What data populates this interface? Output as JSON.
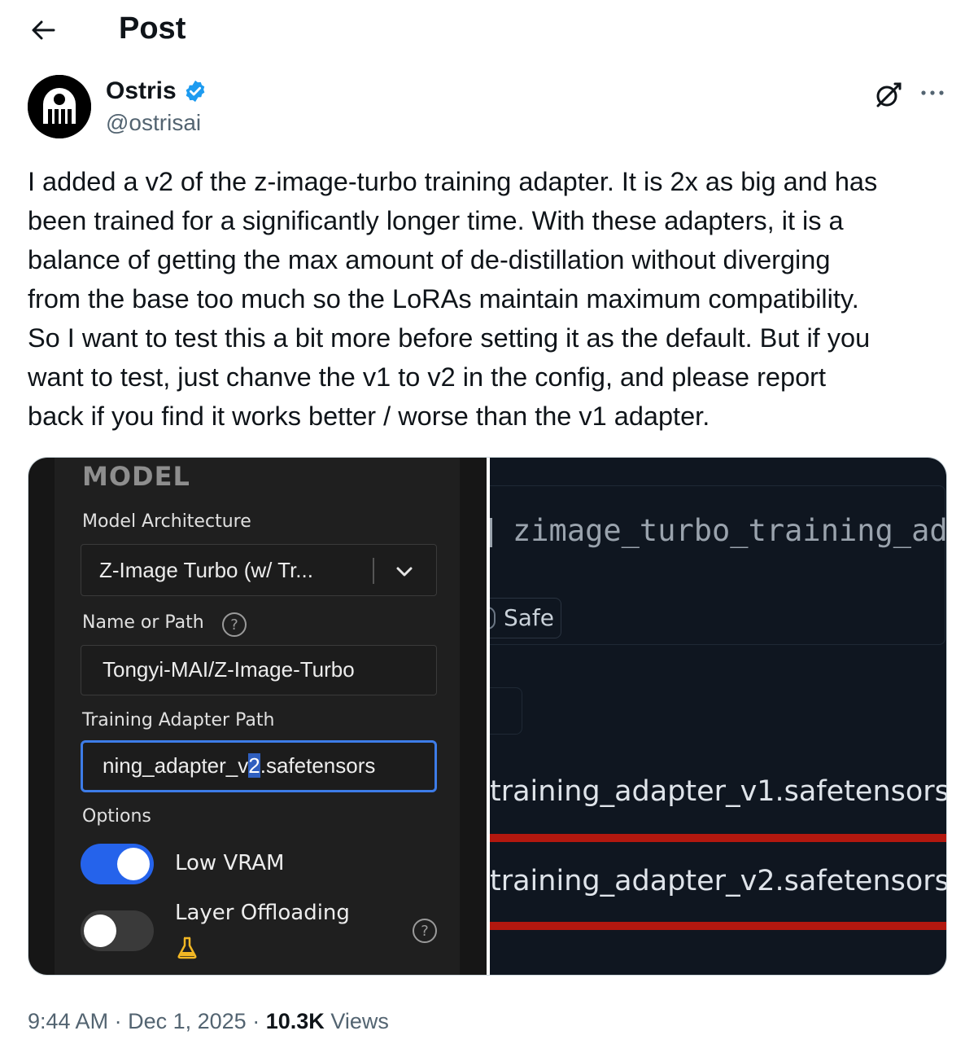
{
  "header": {
    "title": "Post"
  },
  "author": {
    "name": "Ostris",
    "handle": "@ostrisai",
    "verified": true
  },
  "post": {
    "text": "I added a v2 of the z-image-turbo training adapter. It is 2x as big and has\nbeen trained for a significantly longer time. With these adapters, it is a\nbalance of getting the max amount of de-distillation without diverging\nfrom the base too much so the LoRAs maintain maximum compatibility.\nSo I want to test this a bit more before setting it as the default. But if you\nwant to test, just chanve the v1 to v2 in the config, and please report\nback if you find it works better / worse than the v1 adapter."
  },
  "media": {
    "left": {
      "section_title": "MODEL",
      "arch_label": "Model Architecture",
      "arch_value": "Z-Image Turbo (w/ Tr...",
      "name_label": "Name or Path",
      "name_value": "Tongyi-MAI/Z-Image-Turbo",
      "adapter_label": "Training Adapter Path",
      "adapter_value_pre": "ning_adapter_v",
      "adapter_value_cursor": "2",
      "adapter_value_post": ".safetensors",
      "options_label": "Options",
      "low_vram_label": "Low VRAM",
      "low_vram_on": true,
      "layer_offload_label": "Layer Offloading",
      "layer_offload_on": false,
      "help_glyph": "?"
    },
    "right": {
      "repo_text": "zimage_turbo_training_ad",
      "safe_badge": "Safe",
      "file_v1": "training_adapter_v1.safetensors",
      "file_v2": "training_adapter_v2.safetensors",
      "highlight_color": "#b3180f"
    }
  },
  "meta": {
    "time": "9:44 AM",
    "sep1": "·",
    "date": "Dec 1, 2025",
    "sep2": "·",
    "views_count": "10.3K",
    "views_label": "Views"
  },
  "icons": {
    "back": "arrow-left-icon",
    "verified": "verified-badge-icon",
    "grok": "grok-icon",
    "more": "more-icon"
  },
  "colors": {
    "accent": "#1d9bf0",
    "toggle_on": "#2563eb"
  }
}
